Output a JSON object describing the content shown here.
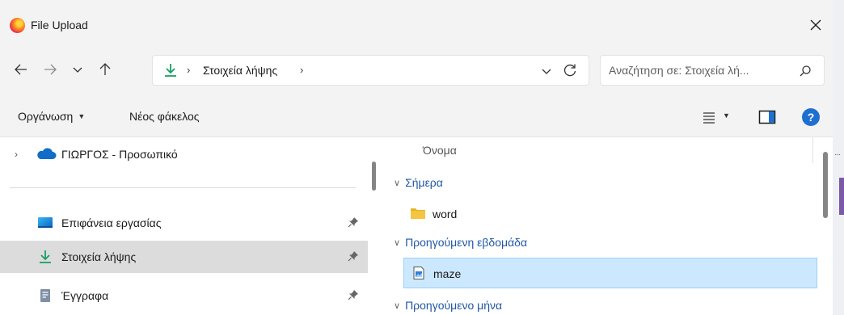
{
  "window": {
    "title": "File Upload"
  },
  "address": {
    "crumbs": [
      "Στοιχεία λήψης"
    ],
    "search_placeholder": "Αναζήτηση σε: Στοιχεία λή..."
  },
  "toolbar": {
    "organize_label": "Οργάνωση",
    "new_folder_label": "Νέος φάκελος"
  },
  "nav_pane": {
    "onedrive_label": "ΓΙΩΡΓΟΣ - Προσωπικό",
    "items": [
      {
        "label": "Επιφάνεια εργασίας",
        "icon": "desktop-icon",
        "pinned": true
      },
      {
        "label": "Στοιχεία λήψης",
        "icon": "download-icon",
        "pinned": true,
        "selected": true
      },
      {
        "label": "Έγγραφα",
        "icon": "document-icon",
        "pinned": true
      }
    ]
  },
  "content": {
    "column_name": "Όνομα",
    "groups": [
      {
        "label": "Σήμερα",
        "files": [
          {
            "name": "word",
            "type": "folder"
          }
        ]
      },
      {
        "label": "Προηγούμενη εβδομάδα",
        "files": [
          {
            "name": "maze",
            "type": "image",
            "selected": true
          }
        ]
      },
      {
        "label": "Προηγούμενο μήνα",
        "files": []
      }
    ]
  },
  "colors": {
    "accent_blue": "#1f6fd1",
    "download_green": "#1a9e64",
    "selection_blue": "#cce8ff",
    "folder_yellow": "#f4c542"
  }
}
